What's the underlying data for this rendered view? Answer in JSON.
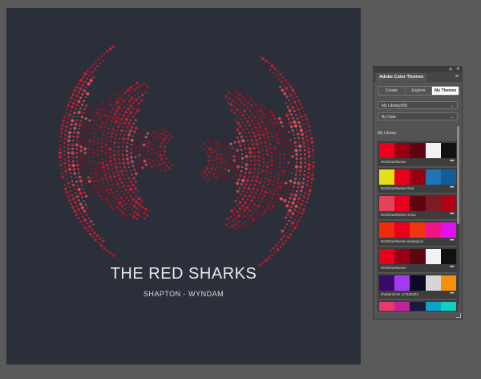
{
  "artwork": {
    "title": "THE RED SHARKS",
    "subtitle": "SHAPTON - WYNDAM",
    "background": "#2b2f3a",
    "dot_colors": [
      "#e01b2f",
      "#c8142a",
      "#a31226",
      "#7d1020",
      "#ee4a55"
    ]
  },
  "panel": {
    "title": "Adobe Color Themes",
    "tabs": [
      {
        "label": "Create",
        "active": false
      },
      {
        "label": "Explore",
        "active": false
      },
      {
        "label": "My Themes",
        "active": true
      }
    ],
    "library_dropdown": "My Library(50)",
    "sort_dropdown": "By Date",
    "section_label": "My Library",
    "more_glyph": "•••",
    "themes": [
      {
        "name": "RedSharkNews",
        "colors": [
          "#e8001c",
          "#960012",
          "#5e0610",
          "#f2f2f2",
          "#111111"
        ]
      },
      {
        "name": "RedSharkNews triad",
        "colors": [
          "#e4e11a",
          "#e8001c",
          "#960012",
          "#1e74b4",
          "#145d94"
        ]
      },
      {
        "name": "RedSharkNews mono",
        "colors": [
          "#e3435a",
          "#e8001c",
          "#5e0610",
          "#7e1a24",
          "#b00016"
        ]
      },
      {
        "name": "RedSharkNews analogous",
        "colors": [
          "#f22a10",
          "#e8001c",
          "#f03510",
          "#f01488",
          "#e010f0"
        ]
      },
      {
        "name": "RedSharkNews",
        "colors": [
          "#e8001c",
          "#960012",
          "#5e0610",
          "#f2f2f2",
          "#111111"
        ]
      },
      {
        "name": "shutterstock_57326204",
        "colors": [
          "#3a0a6a",
          "#a43af0",
          "#0a0a24",
          "#d6d6d6",
          "#f5900a"
        ]
      },
      {
        "name": "",
        "colors": [
          "#e83a6a",
          "#c0249a",
          "#1a1a3a",
          "#10a0c8",
          "#10d0c0"
        ]
      }
    ]
  }
}
